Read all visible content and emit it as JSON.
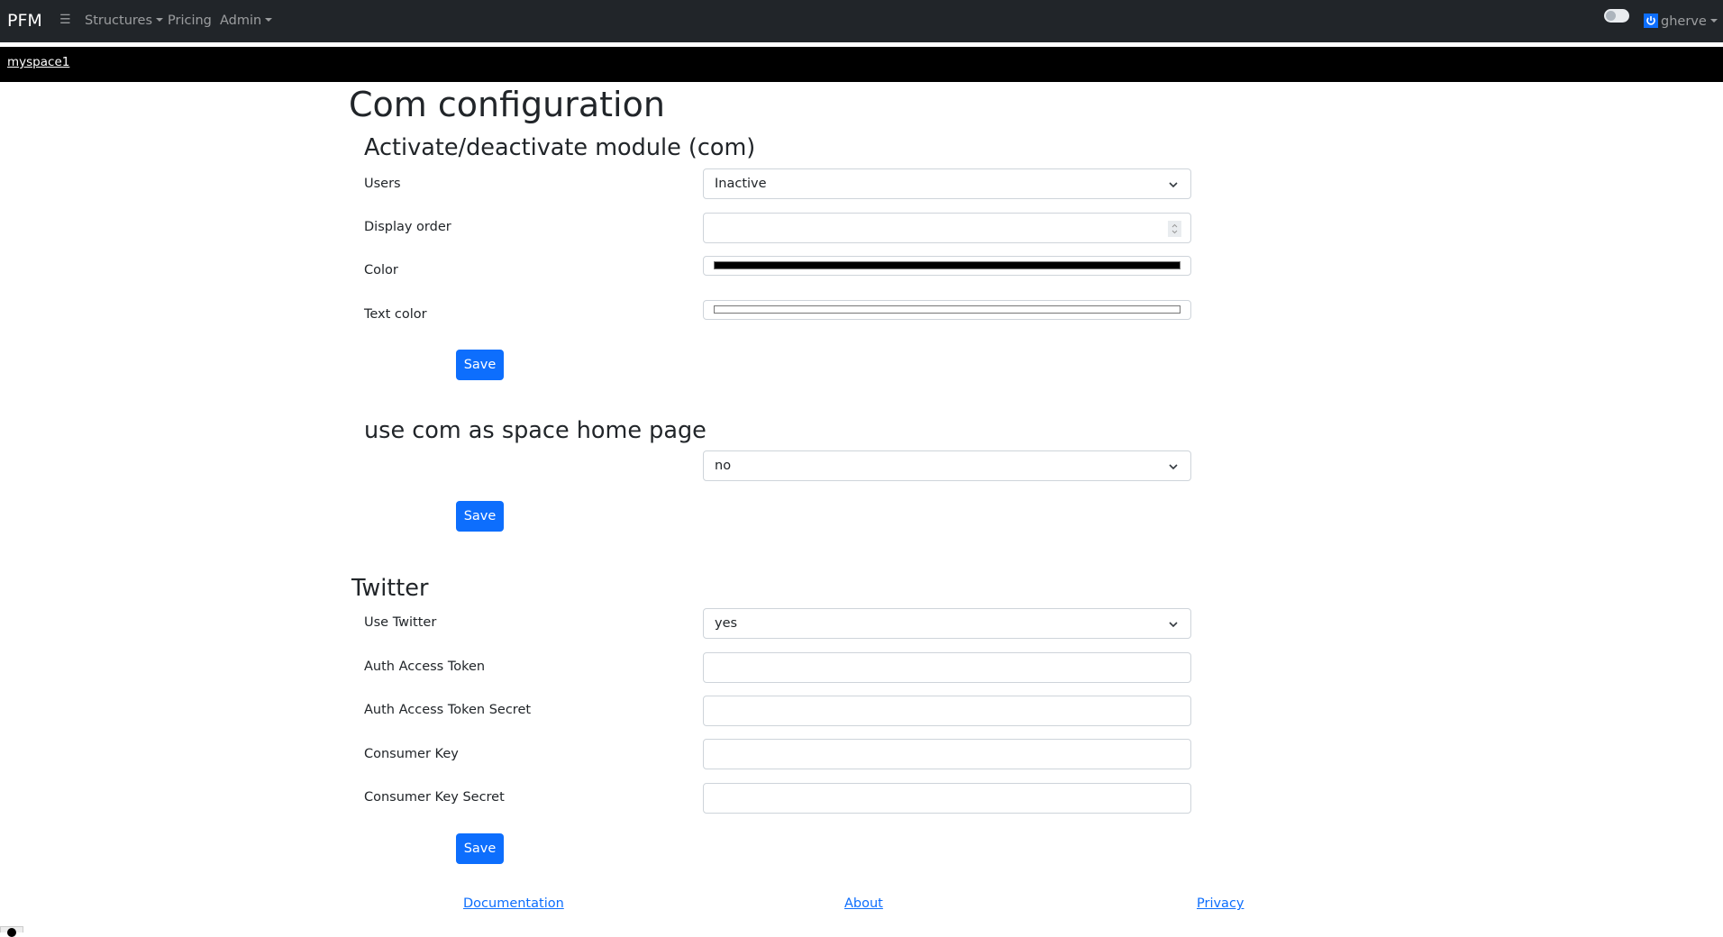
{
  "navbar": {
    "brand": "PFM",
    "menu_icon": "hamburger-icon",
    "items": [
      {
        "label": "Structures",
        "dropdown": true
      },
      {
        "label": "Pricing",
        "dropdown": false
      },
      {
        "label": "Admin",
        "dropdown": true
      }
    ],
    "theme_toggle": {
      "state": "off"
    },
    "user": {
      "name": "gherve",
      "icon": "power-icon",
      "dropdown": true
    }
  },
  "space_bar": {
    "link": "myspace1"
  },
  "page": {
    "title": "Com configuration",
    "sections": {
      "activation": {
        "heading": "Activate/deactivate module (com)",
        "fields": {
          "users": {
            "label": "Users",
            "value": "Inactive"
          },
          "display_order": {
            "label": "Display order",
            "value": ""
          },
          "color": {
            "label": "Color",
            "value": "#000000"
          },
          "text_color": {
            "label": "Text color",
            "value": "#ffffff"
          }
        },
        "save_label": "Save"
      },
      "home_page": {
        "heading": "use com as space home page",
        "value": "no",
        "save_label": "Save"
      },
      "twitter": {
        "heading": "Twitter",
        "fields": {
          "use_twitter": {
            "label": "Use Twitter",
            "value": "yes"
          },
          "auth_access_token": {
            "label": "Auth Access Token",
            "value": ""
          },
          "auth_access_token_secret": {
            "label": "Auth Access Token Secret",
            "value": ""
          },
          "consumer_key": {
            "label": "Consumer Key",
            "value": ""
          },
          "consumer_key_secret": {
            "label": "Consumer Key Secret",
            "value": ""
          }
        },
        "save_label": "Save"
      }
    }
  },
  "footer": {
    "links": [
      "Documentation",
      "About",
      "Privacy"
    ]
  },
  "colors": {
    "navbar_bg": "#212529",
    "space_bar_bg": "#000000",
    "primary": "#0d6efd"
  }
}
